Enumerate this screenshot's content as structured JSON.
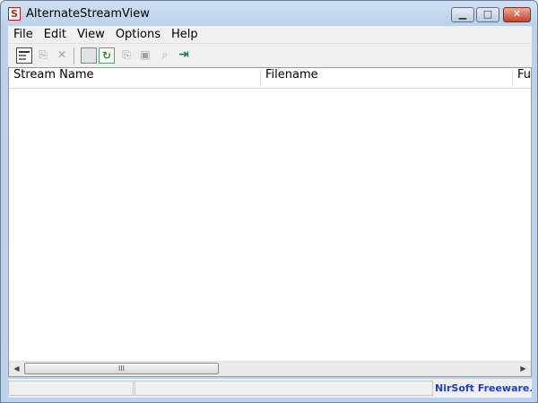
{
  "window": {
    "title": "AlternateStreamView",
    "icon": "S"
  },
  "controls": {
    "minimize": "▁",
    "maximize": "□",
    "close": "✕"
  },
  "menu": [
    "File",
    "Edit",
    "View",
    "Options",
    "Help"
  ],
  "toolbar": {
    "buttons": [
      {
        "icon": "properties-icon",
        "glyph": ""
      },
      {
        "icon": "copy-extract-icon",
        "glyph": "⎘"
      },
      {
        "icon": "delete-icon",
        "glyph": "✕"
      },
      {
        "icon": "save-icon",
        "glyph": ""
      },
      {
        "icon": "refresh-icon",
        "glyph": "↻"
      },
      {
        "icon": "copy-icon",
        "glyph": "⎘"
      },
      {
        "icon": "options-icon",
        "glyph": "▣"
      },
      {
        "icon": "find-icon",
        "glyph": "⌕"
      },
      {
        "icon": "exit-icon",
        "glyph": "⇥"
      }
    ]
  },
  "table": {
    "columns": [
      "Stream Name",
      "Filename",
      "Full"
    ],
    "rows": []
  },
  "scrollbar": {
    "left_arrow": "◀",
    "right_arrow": "▶",
    "grip": "III"
  },
  "statusbar": {
    "link": "NirSoft Freeware. htt"
  }
}
